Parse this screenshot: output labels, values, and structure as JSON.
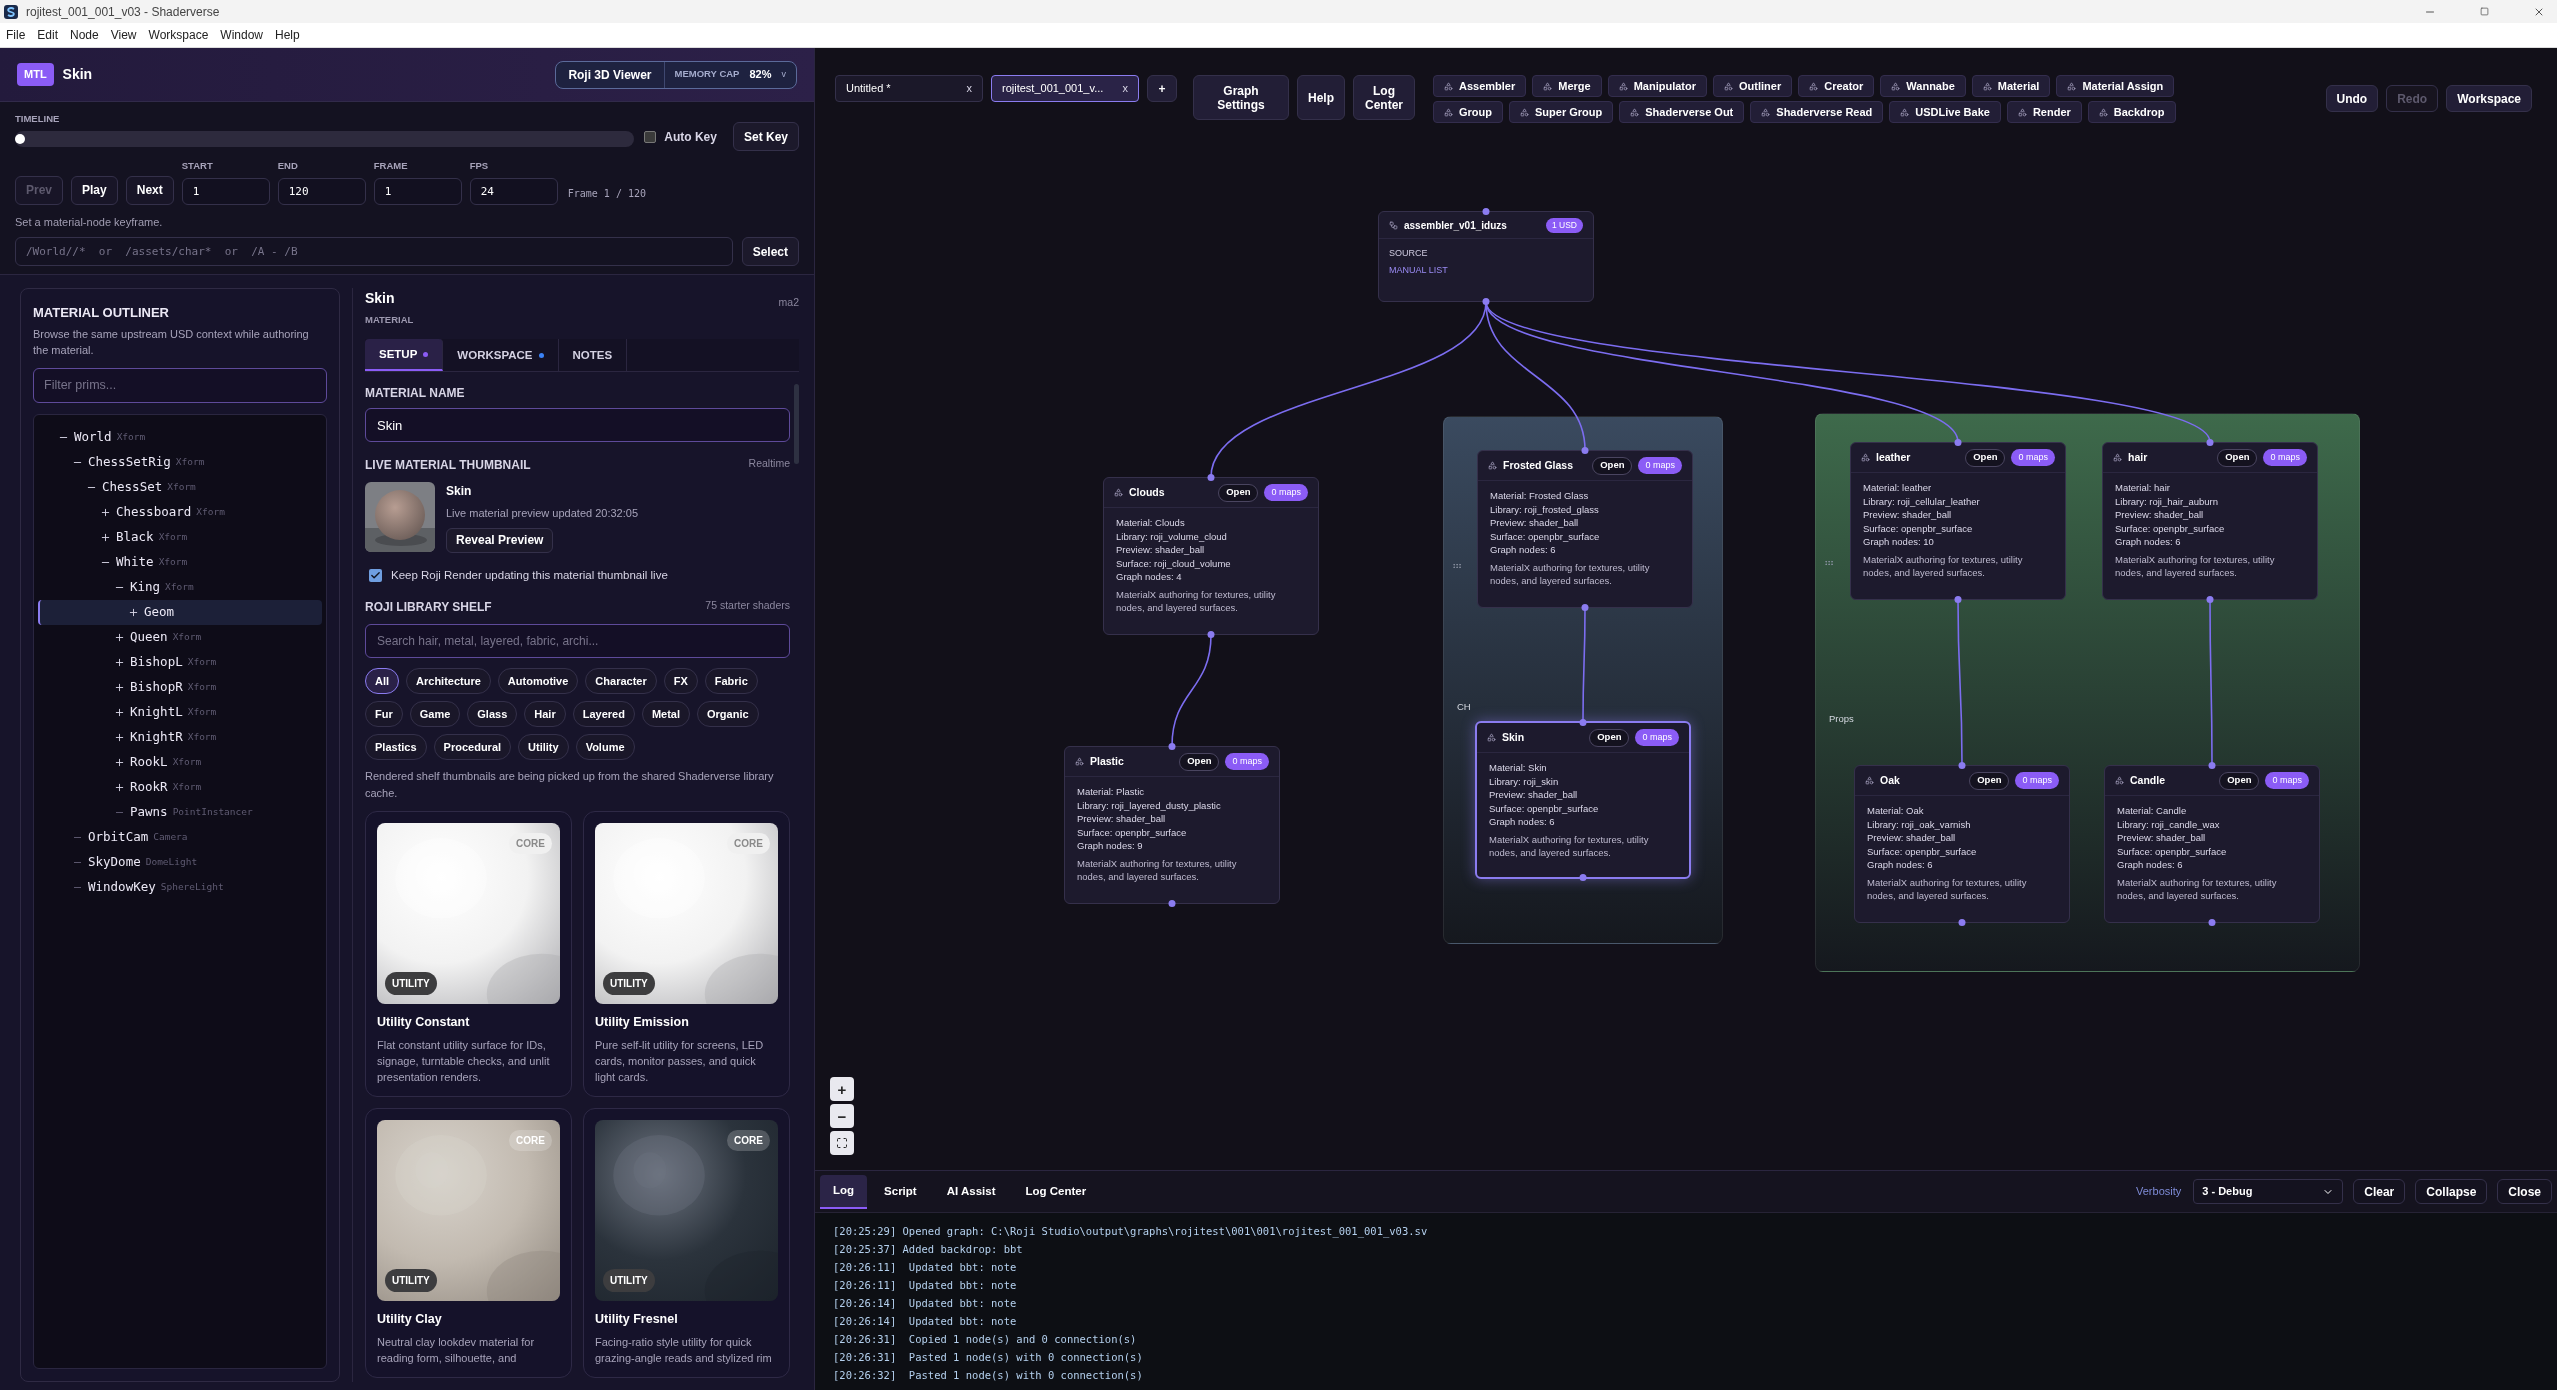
{
  "window": {
    "title": "rojitest_001_001_v03 - Shaderverse"
  },
  "menu": [
    "File",
    "Edit",
    "Node",
    "View",
    "Workspace",
    "Window",
    "Help"
  ],
  "header": {
    "badge": "MTL",
    "title": "Skin",
    "viewer_button": "Roji 3D Viewer",
    "memory_label": "MEMORY CAP",
    "memory_value": "82%",
    "memory_caret": "v"
  },
  "timeline": {
    "label": "TIMELINE",
    "level": 0,
    "auto_key": {
      "label": "Auto Key",
      "checked": false
    },
    "set_key": "Set Key",
    "buttons": [
      {
        "label": "Prev",
        "disabled": true
      },
      {
        "label": "Play",
        "disabled": false
      },
      {
        "label": "Next",
        "disabled": false
      }
    ],
    "fields": [
      {
        "label": "START",
        "value": "1"
      },
      {
        "label": "END",
        "value": "120"
      },
      {
        "label": "FRAME",
        "value": "1"
      },
      {
        "label": "FPS",
        "value": "24"
      }
    ],
    "frame_readout": "Frame 1 / 120",
    "hint": "Set a material-node keyframe.",
    "path_placeholder": "/World//*  or  /assets/char*  or  /A - /B",
    "select": "Select"
  },
  "outliner": {
    "title": "MATERIAL OUTLINER",
    "description": "Browse the same upstream USD context while authoring the material.",
    "filter_placeholder": "Filter prims...",
    "tree": [
      {
        "name": "World",
        "type": "Xform",
        "kind": "branch",
        "expanded": true,
        "selected": false,
        "children": [
          {
            "name": "ChessSetRig",
            "type": "Xform",
            "kind": "branch",
            "expanded": true,
            "selected": false,
            "children": [
              {
                "name": "ChessSet",
                "type": "Xform",
                "kind": "branch",
                "expanded": true,
                "selected": false,
                "children": [
                  {
                    "name": "Chessboard",
                    "type": "Xform",
                    "kind": "branch",
                    "expanded": false,
                    "selected": false
                  },
                  {
                    "name": "Black",
                    "type": "Xform",
                    "kind": "branch",
                    "expanded": false,
                    "selected": false
                  },
                  {
                    "name": "White",
                    "type": "Xform",
                    "kind": "branch",
                    "expanded": true,
                    "selected": false,
                    "children": [
                      {
                        "name": "King",
                        "type": "Xform",
                        "kind": "branch",
                        "expanded": true,
                        "selected": false,
                        "children": [
                          {
                            "name": "Geom",
                            "kind": "branch",
                            "expanded": false,
                            "selected": true
                          }
                        ]
                      },
                      {
                        "name": "Queen",
                        "type": "Xform",
                        "kind": "branch",
                        "expanded": false,
                        "selected": false
                      },
                      {
                        "name": "BishopL",
                        "type": "Xform",
                        "kind": "branch",
                        "expanded": false,
                        "selected": false
                      },
                      {
                        "name": "BishopR",
                        "type": "Xform",
                        "kind": "branch",
                        "expanded": false,
                        "selected": false
                      },
                      {
                        "name": "KnightL",
                        "type": "Xform",
                        "kind": "branch",
                        "expanded": false,
                        "selected": false
                      },
                      {
                        "name": "KnightR",
                        "type": "Xform",
                        "kind": "branch",
                        "expanded": false,
                        "selected": false
                      },
                      {
                        "name": "RookL",
                        "type": "Xform",
                        "kind": "branch",
                        "expanded": false,
                        "selected": false
                      },
                      {
                        "name": "RookR",
                        "type": "Xform",
                        "kind": "branch",
                        "expanded": false,
                        "selected": false
                      },
                      {
                        "name": "Pawns",
                        "type": "PointInstancer",
                        "kind": "leaf",
                        "selected": false
                      }
                    ]
                  }
                ]
              }
            ]
          },
          {
            "name": "OrbitCam",
            "type": "Camera",
            "kind": "leaf",
            "selected": false
          },
          {
            "name": "SkyDome",
            "type": "DomeLight",
            "kind": "leaf",
            "selected": false
          },
          {
            "name": "WindowKey",
            "type": "SphereLight",
            "kind": "leaf",
            "selected": false
          }
        ]
      }
    ]
  },
  "detail": {
    "title": "Skin",
    "subtitle": "MATERIAL",
    "id": "ma2",
    "tabs": [
      {
        "label": "SETUP",
        "selected": true,
        "color": "#8b5cf6"
      },
      {
        "label": "WORKSPACE",
        "selected": false,
        "color": "#3b82f6"
      },
      {
        "label": "NOTES",
        "selected": false
      }
    ],
    "material_name": {
      "label": "MATERIAL NAME",
      "value": "Skin"
    },
    "thumbnail": {
      "label": "LIVE MATERIAL THUMBNAIL",
      "mode": "Realtime",
      "name": "Skin",
      "status": "Live material preview updated 20:32:05",
      "button": "Reveal Preview",
      "live": {
        "label": "Keep Roji Render updating this material thumbnail live",
        "checked": true
      }
    },
    "shelf": {
      "title": "ROJI LIBRARY SHELF",
      "count": "75 starter shaders",
      "search_placeholder": "Search hair, metal, layered, fabric, archi...",
      "chips": [
        {
          "label": "All",
          "selected": true
        },
        {
          "label": "Architecture",
          "selected": false
        },
        {
          "label": "Automotive",
          "selected": false
        },
        {
          "label": "Character",
          "selected": false
        },
        {
          "label": "FX",
          "selected": false
        },
        {
          "label": "Fabric",
          "selected": false
        },
        {
          "label": "Fur",
          "selected": false
        },
        {
          "label": "Game",
          "selected": false
        },
        {
          "label": "Glass",
          "selected": false
        },
        {
          "label": "Hair",
          "selected": false
        },
        {
          "label": "Layered",
          "selected": false
        },
        {
          "label": "Metal",
          "selected": false
        },
        {
          "label": "Organic",
          "selected": false
        },
        {
          "label": "Plastics",
          "selected": false
        },
        {
          "label": "Procedural",
          "selected": false
        },
        {
          "label": "Utility",
          "selected": false
        },
        {
          "label": "Volume",
          "selected": false
        }
      ],
      "note": "Rendered shelf thumbnails are being picked up from the shared Shaderverse library cache.",
      "cards": [
        {
          "title": "Utility Constant",
          "description": "Flat constant utility surface for IDs, signage, turntable checks, and unlit presentation renders.",
          "category": "UTILITY",
          "tier": "CORE",
          "kind": "bright"
        },
        {
          "title": "Utility Emission",
          "description": "Pure self-lit utility for screens, LED cards, monitor passes, and quick light cards.",
          "category": "UTILITY",
          "tier": "CORE",
          "kind": "bright"
        },
        {
          "title": "Utility Clay",
          "description": "Neutral clay lookdev material for reading form, silhouette, and",
          "category": "UTILITY",
          "tier": "CORE",
          "kind": "clay"
        },
        {
          "title": "Utility Fresnel",
          "description": "Facing-ratio style utility for quick grazing-angle reads and stylized rim",
          "category": "UTILITY",
          "tier": "CORE",
          "kind": "dark"
        }
      ]
    }
  },
  "graph": {
    "tabs": [
      {
        "label": "Untitled *",
        "close": "x",
        "selected": false
      },
      {
        "label": "rojitest_001_001_v...",
        "close": "x",
        "selected": true
      }
    ],
    "add_tab": "+",
    "buttons": [
      "Graph Settings",
      "Help",
      "Log Center"
    ],
    "palette": [
      [
        "Assembler",
        "Merge",
        "Manipulator",
        "Outliner",
        "Creator",
        "Wannabe",
        "Material",
        "Material Assign"
      ],
      [
        "Group",
        "Super Group",
        "Shaderverse Out",
        "Shaderverse Read",
        "USDLive Bake",
        "Render",
        "Backdrop"
      ]
    ],
    "history": [
      {
        "label": "Undo",
        "disabled": false
      },
      {
        "label": "Redo",
        "disabled": true
      }
    ],
    "workspace": "Workspace"
  },
  "canvas": {
    "backdrops": [
      {
        "label": "CH",
        "color": "#3a4a5f"
      },
      {
        "label": "Props",
        "color": "#3e6a4b"
      }
    ],
    "assembler": {
      "title": "assembler_v01_iduzs",
      "badge": "1 USD",
      "source_label": "SOURCE",
      "source_value": "MANUAL LIST"
    },
    "nodes": [
      {
        "title": "Clouds",
        "open": "Open",
        "maps": "0 maps",
        "selected": false,
        "fields": [
          "Material: Clouds",
          "Library: roji_volume_cloud",
          "Preview: shader_ball",
          "Surface: roji_cloud_volume",
          "Graph nodes: 4"
        ],
        "description": "MaterialX authoring for textures, utility nodes, and layered surfaces."
      },
      {
        "title": "Frosted Glass",
        "open": "Open",
        "maps": "0 maps",
        "selected": false,
        "fields": [
          "Material: Frosted Glass",
          "Library: roji_frosted_glass",
          "Preview: shader_ball",
          "Surface: openpbr_surface",
          "Graph nodes: 6"
        ],
        "description": "MaterialX authoring for textures, utility nodes, and layered surfaces."
      },
      {
        "title": "leather",
        "open": "Open",
        "maps": "0 maps",
        "selected": false,
        "fields": [
          "Material: leather",
          "Library: roji_cellular_leather",
          "Preview: shader_ball",
          "Surface: openpbr_surface",
          "Graph nodes: 10"
        ],
        "description": "MaterialX authoring for textures, utility nodes, and layered surfaces."
      },
      {
        "title": "hair",
        "open": "Open",
        "maps": "0 maps",
        "selected": false,
        "fields": [
          "Material: hair",
          "Library: roji_hair_auburn",
          "Preview: shader_ball",
          "Surface: openpbr_surface",
          "Graph nodes: 6"
        ],
        "description": "MaterialX authoring for textures, utility nodes, and layered surfaces."
      },
      {
        "title": "Plastic",
        "open": "Open",
        "maps": "0 maps",
        "selected": false,
        "fields": [
          "Material: Plastic",
          "Library: roji_layered_dusty_plastic",
          "Preview: shader_ball",
          "Surface: openpbr_surface",
          "Graph nodes: 9"
        ],
        "description": "MaterialX authoring for textures, utility nodes, and layered surfaces."
      },
      {
        "title": "Skin",
        "open": "Open",
        "maps": "0 maps",
        "selected": true,
        "fields": [
          "Material: Skin",
          "Library: roji_skin",
          "Preview: shader_ball",
          "Surface: openpbr_surface",
          "Graph nodes: 6"
        ],
        "description": "MaterialX authoring for textures, utility nodes, and layered surfaces."
      },
      {
        "title": "Oak",
        "open": "Open",
        "maps": "0 maps",
        "selected": false,
        "fields": [
          "Material: Oak",
          "Library: roji_oak_varnish",
          "Preview: shader_ball",
          "Surface: openpbr_surface",
          "Graph nodes: 6"
        ],
        "description": "MaterialX authoring for textures, utility nodes, and layered surfaces."
      },
      {
        "title": "Candle",
        "open": "Open",
        "maps": "0 maps",
        "selected": false,
        "fields": [
          "Material: Candle",
          "Library: roji_candle_wax",
          "Preview: shader_ball",
          "Surface: openpbr_surface",
          "Graph nodes: 6"
        ],
        "description": "MaterialX authoring for textures, utility nodes, and layered surfaces."
      }
    ],
    "zoom": [
      "+",
      "−"
    ]
  },
  "log": {
    "tabs": [
      {
        "label": "Log",
        "selected": true
      },
      {
        "label": "Script",
        "selected": false
      },
      {
        "label": "AI Assist",
        "selected": false
      },
      {
        "label": "Log Center",
        "selected": false
      }
    ],
    "verbosity_label": "Verbosity",
    "verbosity": "3 - Debug",
    "buttons": [
      "Clear",
      "Collapse",
      "Close"
    ],
    "lines": [
      "[20:25:29] Opened graph: C:\\Roji Studio\\output\\graphs\\rojitest\\001\\001\\rojitest_001_001_v03.sv",
      "[20:25:37] Added backdrop: bbt",
      "[20:26:11]  Updated bbt: note",
      "[20:26:11]  Updated bbt: note",
      "[20:26:14]  Updated bbt: note",
      "[20:26:14]  Updated bbt: note",
      "[20:26:31]  Copied 1 node(s) and 0 connection(s)",
      "[20:26:31]  Pasted 1 node(s) with 0 connection(s)",
      "[20:26:32]  Pasted 1 node(s) with 0 connection(s)"
    ]
  }
}
